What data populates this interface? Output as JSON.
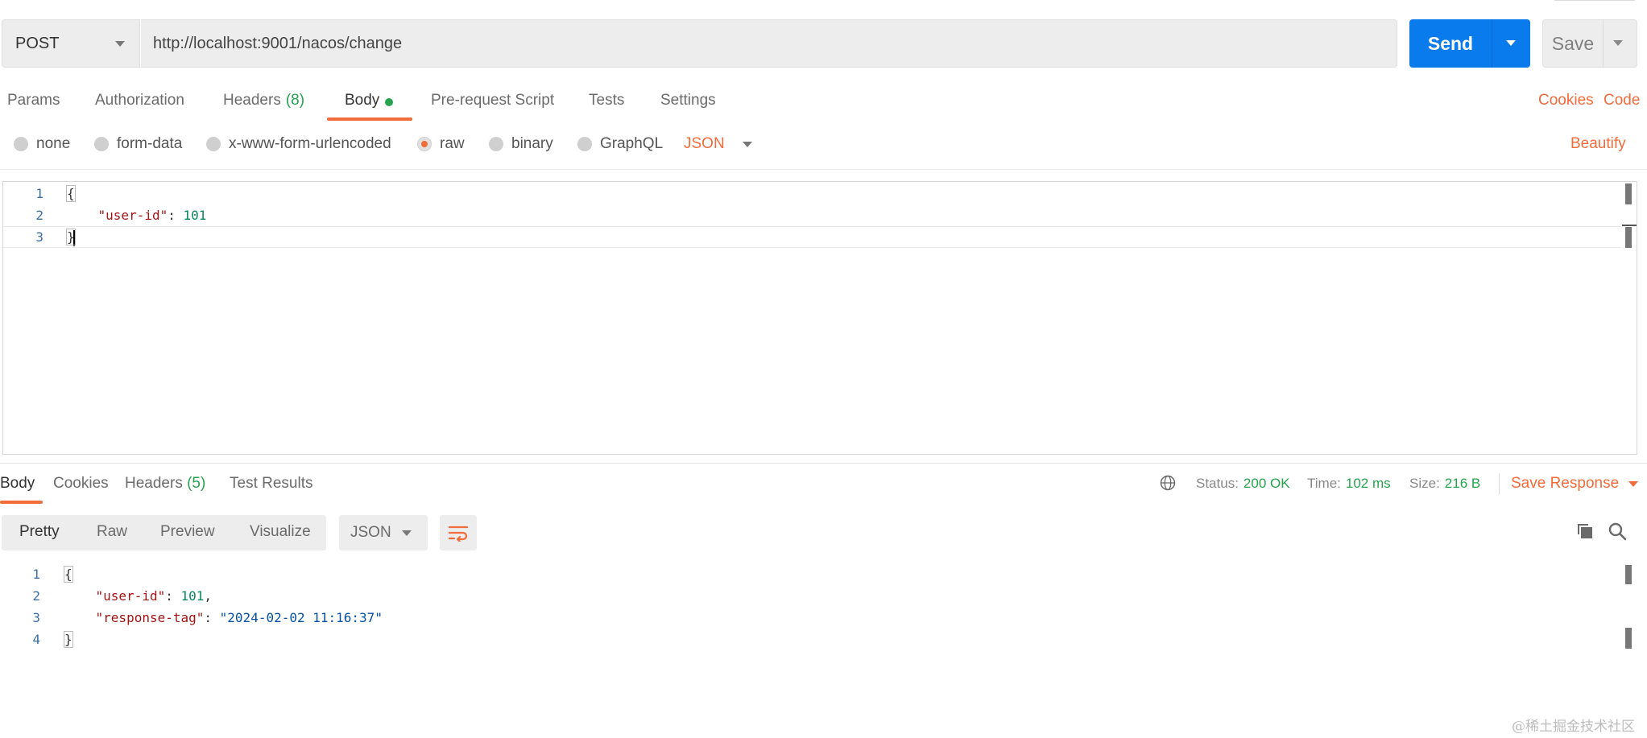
{
  "request": {
    "method": "POST",
    "url": "http://localhost:9001/nacos/change",
    "send_label": "Send",
    "save_label": "Save"
  },
  "request_tabs": {
    "items": [
      {
        "label": "Params"
      },
      {
        "label": "Authorization"
      },
      {
        "label": "Headers",
        "count": "(8)"
      },
      {
        "label": "Body"
      },
      {
        "label": "Pre-request Script"
      },
      {
        "label": "Tests"
      },
      {
        "label": "Settings"
      }
    ],
    "active": "Body",
    "cookies_label": "Cookies",
    "code_label": "Code"
  },
  "body_types": {
    "options": [
      "none",
      "form-data",
      "x-www-form-urlencoded",
      "raw",
      "binary",
      "GraphQL"
    ],
    "selected": "raw",
    "language": "JSON",
    "beautify_label": "Beautify"
  },
  "request_body": {
    "line_numbers": [
      "1",
      "2",
      "3"
    ],
    "open_brace": "{",
    "key": "\"user-id\"",
    "colon": ": ",
    "value": "101",
    "close_brace": "}"
  },
  "response_tabs": {
    "items": [
      {
        "label": "Body"
      },
      {
        "label": "Cookies"
      },
      {
        "label": "Headers",
        "count": "(5)"
      },
      {
        "label": "Test Results"
      }
    ],
    "active": "Body"
  },
  "response_status": {
    "status_label": "Status:",
    "status_value": "200 OK",
    "time_label": "Time:",
    "time_value": "102 ms",
    "size_label": "Size:",
    "size_value": "216 B",
    "save_response_label": "Save Response"
  },
  "response_view": {
    "modes": [
      "Pretty",
      "Raw",
      "Preview",
      "Visualize"
    ],
    "active": "Pretty",
    "language": "JSON"
  },
  "response_body": {
    "line_numbers": [
      "1",
      "2",
      "3",
      "4"
    ],
    "open_brace": "{",
    "key1": "\"user-id\"",
    "value1": "101",
    "comma": ",",
    "key2": "\"response-tag\"",
    "value2": "\"2024-02-02 11:16:37\"",
    "close_brace": "}"
  },
  "watermark": "@稀土掘金技术社区",
  "colors": {
    "accent": "#f26b3a",
    "primary": "#097bed",
    "success": "#26a34e"
  }
}
